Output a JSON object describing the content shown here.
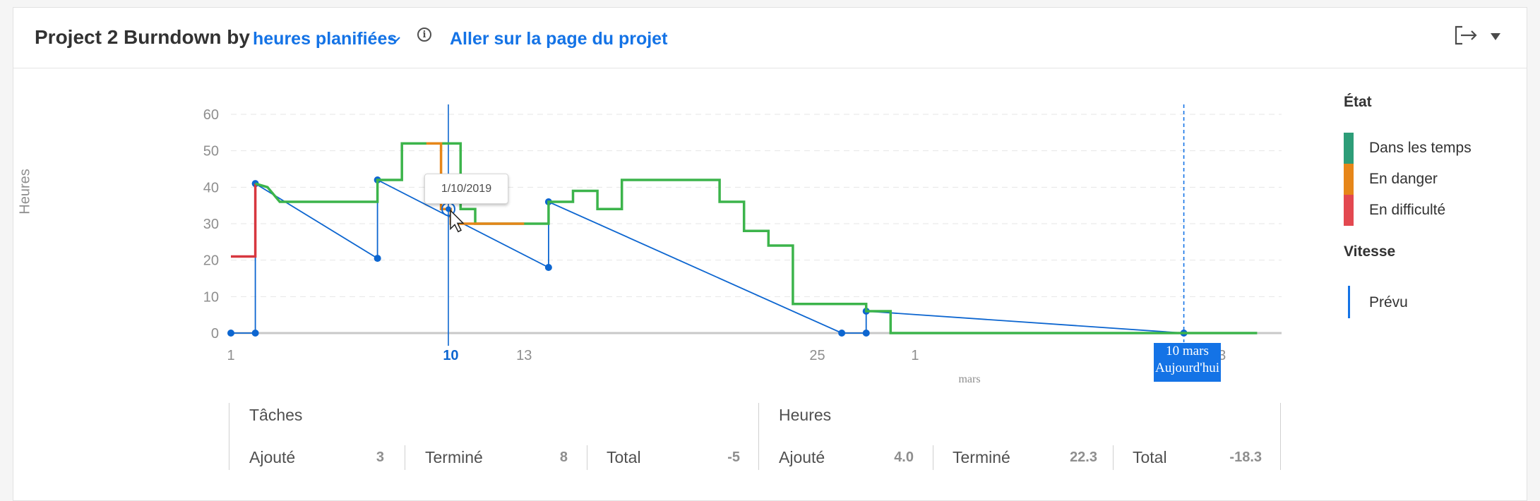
{
  "header": {
    "title": "Project 2 Burndown by",
    "measure": "heures planifiées",
    "project_link": "Aller sur la page du projet"
  },
  "chart_data": {
    "type": "line",
    "ylabel": "Heures",
    "xlabel": "mars",
    "ylim": [
      0,
      60
    ],
    "yticks": [
      0,
      10,
      20,
      30,
      40,
      50,
      60
    ],
    "x_tick_labels": [
      "1",
      "10",
      "13",
      "25",
      "1",
      "13"
    ],
    "x_range_days": [
      1,
      44
    ],
    "grid": true,
    "legend_position": "right",
    "series": [
      {
        "name": "Dans les temps",
        "color": "#3cb44b",
        "points": [
          [
            2,
            41
          ],
          [
            2.5,
            40
          ],
          [
            3,
            36
          ],
          [
            7,
            36
          ],
          [
            7,
            42
          ],
          [
            8,
            42
          ],
          [
            8,
            52
          ],
          [
            9,
            52
          ],
          [
            10.4,
            52
          ],
          [
            10.4,
            34
          ],
          [
            11,
            34
          ],
          [
            11,
            30
          ],
          [
            13,
            30
          ],
          [
            14,
            30
          ],
          [
            14,
            36
          ],
          [
            15,
            36
          ],
          [
            15,
            39
          ],
          [
            16,
            39
          ],
          [
            16,
            34
          ],
          [
            17,
            34
          ],
          [
            17,
            42
          ],
          [
            21,
            42
          ],
          [
            21,
            36
          ],
          [
            22,
            36
          ],
          [
            22,
            28
          ],
          [
            23,
            28
          ],
          [
            23,
            24
          ],
          [
            24,
            24
          ],
          [
            24,
            8
          ],
          [
            27,
            8
          ],
          [
            27,
            6
          ],
          [
            28,
            6
          ],
          [
            28,
            0
          ],
          [
            43,
            0
          ]
        ]
      },
      {
        "name": "En danger",
        "color": "#e68619",
        "points": [
          [
            9,
            52
          ],
          [
            9.6,
            52
          ],
          [
            9.6,
            34
          ],
          [
            10,
            34
          ],
          [
            10,
            30
          ],
          [
            13,
            30
          ]
        ]
      },
      {
        "name": "En difficulté",
        "color": "#d7373f",
        "points": [
          [
            1,
            21
          ],
          [
            2,
            21
          ],
          [
            2,
            41
          ]
        ]
      },
      {
        "name": "Prévu",
        "color": "#0d66d0",
        "points": [
          [
            1,
            0
          ],
          [
            2,
            0
          ],
          [
            2,
            41
          ],
          [
            7,
            20.5
          ],
          [
            7,
            42
          ],
          [
            14,
            18
          ],
          [
            14,
            36
          ],
          [
            26,
            0
          ],
          [
            27,
            0
          ],
          [
            27,
            6
          ],
          [
            40,
            0
          ]
        ]
      }
    ],
    "tooltip": "1/10/2019",
    "today_marker": {
      "label_line1": "10 mars",
      "label_line2": "Aujourd'hui"
    }
  },
  "legend": {
    "status_title": "État",
    "status_items": [
      {
        "label": "Dans les temps",
        "color": "#2d9d78"
      },
      {
        "label": "En danger",
        "color": "#e68619"
      },
      {
        "label": "En difficulté",
        "color": "#e34850"
      }
    ],
    "speed_title": "Vitesse",
    "speed_items": [
      {
        "label": "Prévu",
        "color": "#1473e6"
      }
    ]
  },
  "stats": {
    "tasks": {
      "title": "Tâches",
      "added_label": "Ajouté",
      "added": "3",
      "done_label": "Terminé",
      "done": "8",
      "total_label": "Total",
      "total": "-5"
    },
    "hours": {
      "title": "Heures",
      "added_label": "Ajouté",
      "added": "4.0",
      "done_label": "Terminé",
      "done": "22.3",
      "total_label": "Total",
      "total": "-18.3"
    }
  }
}
